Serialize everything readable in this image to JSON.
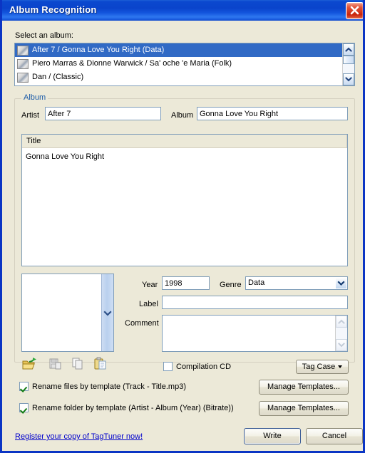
{
  "window": {
    "title": "Album Recognition",
    "close_icon": "close-icon"
  },
  "album_selector": {
    "label": "Select an album:",
    "items": [
      {
        "text": "After 7 / Gonna Love You Right (Data)",
        "icon": "disc-icon",
        "selected": true
      },
      {
        "text": "Piero Marras & Dionne Warwick / Sa' oche 'e Maria (Folk)",
        "icon": "disc-icon",
        "selected": false
      },
      {
        "text": "Dan /  (Classic)",
        "icon": "disc-icon",
        "selected": false
      }
    ],
    "scrollbar": {
      "up_icon": "chevron-up-icon",
      "down_icon": "chevron-down-icon"
    }
  },
  "album_group": {
    "title": "Album",
    "artist": {
      "label": "Artist",
      "value": "After 7",
      "placeholder": ""
    },
    "album": {
      "label": "Album",
      "value": "Gonna Love You Right",
      "placeholder": ""
    },
    "tracks": {
      "column_header": "Title",
      "rows": [
        "Gonna Love You Right"
      ]
    },
    "year": {
      "label": "Year",
      "value": "1998",
      "placeholder": ""
    },
    "genre": {
      "label": "Genre",
      "value": "Data",
      "arrow_icon": "chevron-down-icon",
      "options": [
        "Data"
      ]
    },
    "label_field": {
      "label": "Label",
      "value": "",
      "placeholder": ""
    },
    "comment": {
      "label": "Comment",
      "value": "",
      "placeholder": ""
    },
    "cover_preview": {
      "name": "cover-preview",
      "scrollbar": {
        "down_icon": "chevron-down-icon"
      }
    },
    "toolbar_icons": [
      {
        "name": "open-folder-icon",
        "title": "Load picture from file"
      },
      {
        "name": "save-picture-icon",
        "title": "Save picture to file"
      },
      {
        "name": "copy-icon",
        "title": "Copy"
      },
      {
        "name": "paste-icon",
        "title": "Paste"
      }
    ],
    "compilation": {
      "label": "Compilation CD",
      "checked": false
    },
    "tag_case": {
      "label": "Tag Case",
      "caret_icon": "caret-down-icon"
    }
  },
  "options": {
    "rename_files": {
      "label": "Rename files by template (Track - Title.mp3)",
      "checked": true,
      "button": "Manage Templates..."
    },
    "rename_folder": {
      "label": "Rename folder by template (Artist - Album (Year) (Bitrate))",
      "checked": true,
      "button": "Manage Templates..."
    }
  },
  "footer": {
    "register_link": "Register your copy of TagTuner now!",
    "write_button": "Write",
    "cancel_button": "Cancel"
  },
  "colors": {
    "titlebar_blue": "#0b48cf",
    "dialog_face": "#ece9d8",
    "selection_blue": "#316ac5",
    "group_title_blue": "#1b5ba8",
    "link_blue": "#0000cc",
    "field_border": "#7f9db9"
  }
}
